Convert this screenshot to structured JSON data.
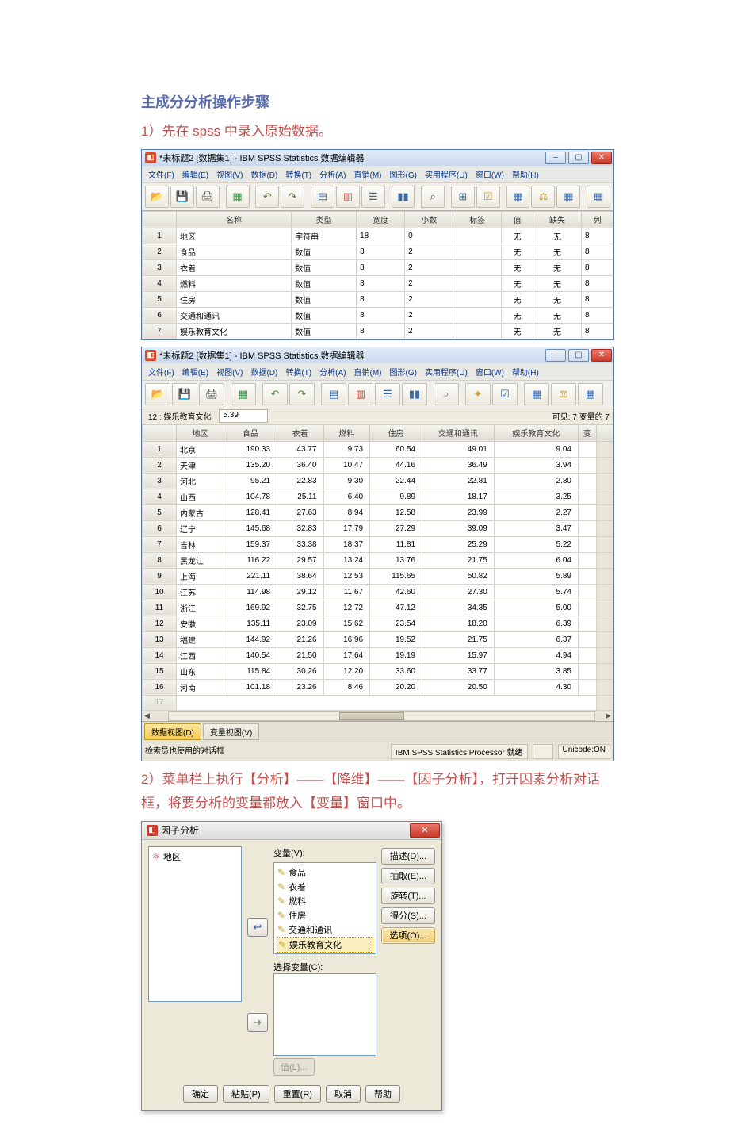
{
  "doc": {
    "title": "主成分分析操作步骤",
    "step1": "1）先在 spss 中录入原始数据。",
    "step2": "2）菜单栏上执行【分析】——【降维】——【因子分析】，打开因素分析对话框，将要分析的变量都放入【变量】窗口中。"
  },
  "win1": {
    "title": "*未标题2 [数据集1] - IBM SPSS Statistics 数据编辑器",
    "menus": [
      "文件(F)",
      "编辑(E)",
      "视图(V)",
      "数据(D)",
      "转换(T)",
      "分析(A)",
      "直销(M)",
      "图形(G)",
      "实用程序(U)",
      "窗口(W)",
      "帮助(H)"
    ],
    "headers": [
      "名称",
      "类型",
      "宽度",
      "小数",
      "标签",
      "值",
      "缺失",
      "列"
    ],
    "rows": [
      {
        "n": "1",
        "name": "地区",
        "type": "字符串",
        "w": "18",
        "d": "0",
        "lbl": "",
        "val": "无",
        "miss": "无",
        "col": "8"
      },
      {
        "n": "2",
        "name": "食品",
        "type": "数值",
        "w": "8",
        "d": "2",
        "lbl": "",
        "val": "无",
        "miss": "无",
        "col": "8"
      },
      {
        "n": "3",
        "name": "衣着",
        "type": "数值",
        "w": "8",
        "d": "2",
        "lbl": "",
        "val": "无",
        "miss": "无",
        "col": "8"
      },
      {
        "n": "4",
        "name": "燃料",
        "type": "数值",
        "w": "8",
        "d": "2",
        "lbl": "",
        "val": "无",
        "miss": "无",
        "col": "8"
      },
      {
        "n": "5",
        "name": "住房",
        "type": "数值",
        "w": "8",
        "d": "2",
        "lbl": "",
        "val": "无",
        "miss": "无",
        "col": "8"
      },
      {
        "n": "6",
        "name": "交通和通讯",
        "type": "数值",
        "w": "8",
        "d": "2",
        "lbl": "",
        "val": "无",
        "miss": "无",
        "col": "8"
      },
      {
        "n": "7",
        "name": "娱乐教育文化",
        "type": "数值",
        "w": "8",
        "d": "2",
        "lbl": "",
        "val": "无",
        "miss": "无",
        "col": "8"
      }
    ]
  },
  "win2": {
    "title": "*未标题2 [数据集1] - IBM SPSS Statistics 数据编辑器",
    "menus": [
      "文件(F)",
      "编辑(E)",
      "视图(V)",
      "数据(D)",
      "转换(T)",
      "分析(A)",
      "直销(M)",
      "图形(G)",
      "实用程序(U)",
      "窗口(W)",
      "帮助(H)"
    ],
    "cell_label": "12 : 娱乐教育文化",
    "cell_value": "5.39",
    "visible_info": "可见: 7 变量的 7",
    "columns": [
      "地区",
      "食品",
      "衣着",
      "燃料",
      "住房",
      "交通和通讯",
      "娱乐教育文化",
      "变"
    ],
    "rows": [
      {
        "n": "1",
        "d": [
          "北京",
          "190.33",
          "43.77",
          "9.73",
          "60.54",
          "49.01",
          "9.04"
        ]
      },
      {
        "n": "2",
        "d": [
          "天津",
          "135.20",
          "36.40",
          "10.47",
          "44.16",
          "36.49",
          "3.94"
        ]
      },
      {
        "n": "3",
        "d": [
          "河北",
          "95.21",
          "22.83",
          "9.30",
          "22.44",
          "22.81",
          "2.80"
        ]
      },
      {
        "n": "4",
        "d": [
          "山西",
          "104.78",
          "25.11",
          "6.40",
          "9.89",
          "18.17",
          "3.25"
        ]
      },
      {
        "n": "5",
        "d": [
          "内蒙古",
          "128.41",
          "27.63",
          "8.94",
          "12.58",
          "23.99",
          "2.27"
        ]
      },
      {
        "n": "6",
        "d": [
          "辽宁",
          "145.68",
          "32.83",
          "17.79",
          "27.29",
          "39.09",
          "3.47"
        ]
      },
      {
        "n": "7",
        "d": [
          "吉林",
          "159.37",
          "33.38",
          "18.37",
          "11.81",
          "25.29",
          "5.22"
        ]
      },
      {
        "n": "8",
        "d": [
          "黑龙江",
          "116.22",
          "29.57",
          "13.24",
          "13.76",
          "21.75",
          "6.04"
        ]
      },
      {
        "n": "9",
        "d": [
          "上海",
          "221.11",
          "38.64",
          "12.53",
          "115.65",
          "50.82",
          "5.89"
        ]
      },
      {
        "n": "10",
        "d": [
          "江苏",
          "114.98",
          "29.12",
          "11.67",
          "42.60",
          "27.30",
          "5.74"
        ]
      },
      {
        "n": "11",
        "d": [
          "浙江",
          "169.92",
          "32.75",
          "12.72",
          "47.12",
          "34.35",
          "5.00"
        ]
      },
      {
        "n": "12",
        "d": [
          "安徽",
          "135.11",
          "23.09",
          "15.62",
          "23.54",
          "18.20",
          "6.39"
        ]
      },
      {
        "n": "13",
        "d": [
          "福建",
          "144.92",
          "21.26",
          "16.96",
          "19.52",
          "21.75",
          "6.37"
        ]
      },
      {
        "n": "14",
        "d": [
          "江西",
          "140.54",
          "21.50",
          "17.64",
          "19.19",
          "15.97",
          "4.94"
        ]
      },
      {
        "n": "15",
        "d": [
          "山东",
          "115.84",
          "30.26",
          "12.20",
          "33.60",
          "33.77",
          "3.85"
        ]
      },
      {
        "n": "16",
        "d": [
          "河南",
          "101.18",
          "23.26",
          "8.46",
          "20.20",
          "20.50",
          "4.30"
        ]
      }
    ],
    "empty_row": "17",
    "tab_data": "数据视图(D)",
    "tab_var": "变量视图(V)",
    "status_left": "检索员也使用的对话框",
    "status_proc": "IBM SPSS Statistics Processor 就绪",
    "status_unicode": "Unicode:ON"
  },
  "dlg": {
    "title": "因子分析",
    "left_var": "地区",
    "vars_label": "变量(V):",
    "vars": [
      "食品",
      "衣着",
      "燃料",
      "住房",
      "交通和通讯",
      "娱乐教育文化"
    ],
    "selvar_label": "选择变量(C):",
    "value_btn": "值(L)...",
    "side_btns": [
      "描述(D)...",
      "抽取(E)...",
      "旋转(T)...",
      "得分(S)...",
      "选项(O)..."
    ],
    "footer": [
      "确定",
      "粘贴(P)",
      "重置(R)",
      "取消",
      "帮助"
    ]
  }
}
